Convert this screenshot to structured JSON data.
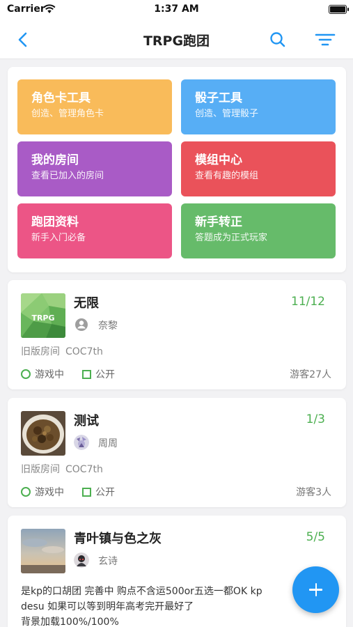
{
  "status_bar": {
    "carrier": "Carrier",
    "time": "1:37 AM"
  },
  "nav": {
    "title": "TRPG跑团",
    "back_icon": "chevron-left-icon",
    "search_icon": "search-icon",
    "filter_icon": "filter-icon",
    "accent": "#2196f3"
  },
  "tiles": [
    {
      "title": "角色卡工具",
      "subtitle": "创造、管理角色卡",
      "color": "#f9bb5a"
    },
    {
      "title": "骰子工具",
      "subtitle": "创造、管理骰子",
      "color": "#57aef5"
    },
    {
      "title": "我的房间",
      "subtitle": "查看已加入的房间",
      "color": "#a95bc6"
    },
    {
      "title": "模组中心",
      "subtitle": "查看有趣的模组",
      "color": "#ea525a"
    },
    {
      "title": "跑团资料",
      "subtitle": "新手入门必备",
      "color": "#ec5586"
    },
    {
      "title": "新手转正",
      "subtitle": "答题成为正式玩家",
      "color": "#66bb6a"
    }
  ],
  "rooms": [
    {
      "name": "无限",
      "count": "11/12",
      "owner": "奈黎",
      "room_type": "旧版房间",
      "rule": "COC7th",
      "status": "游戏中",
      "visibility": "公开",
      "guests": "游客27人",
      "thumb_text": "TRPG"
    },
    {
      "name": "测试",
      "count": "1/3",
      "owner": "周周",
      "room_type": "旧版房间",
      "rule": "COC7th",
      "status": "游戏中",
      "visibility": "公开",
      "guests": "游客3人"
    },
    {
      "name": "青叶镇与色之灰",
      "count": "5/5",
      "owner": "玄诗",
      "desc_lines": [
        "是kp的口胡团 完善中 购点不含运500or五选一都OK kp",
        "desu 如果可以等到明年高考完开最好了",
        "背景加载100%/100%"
      ]
    }
  ],
  "fab_icon": "plus-icon"
}
